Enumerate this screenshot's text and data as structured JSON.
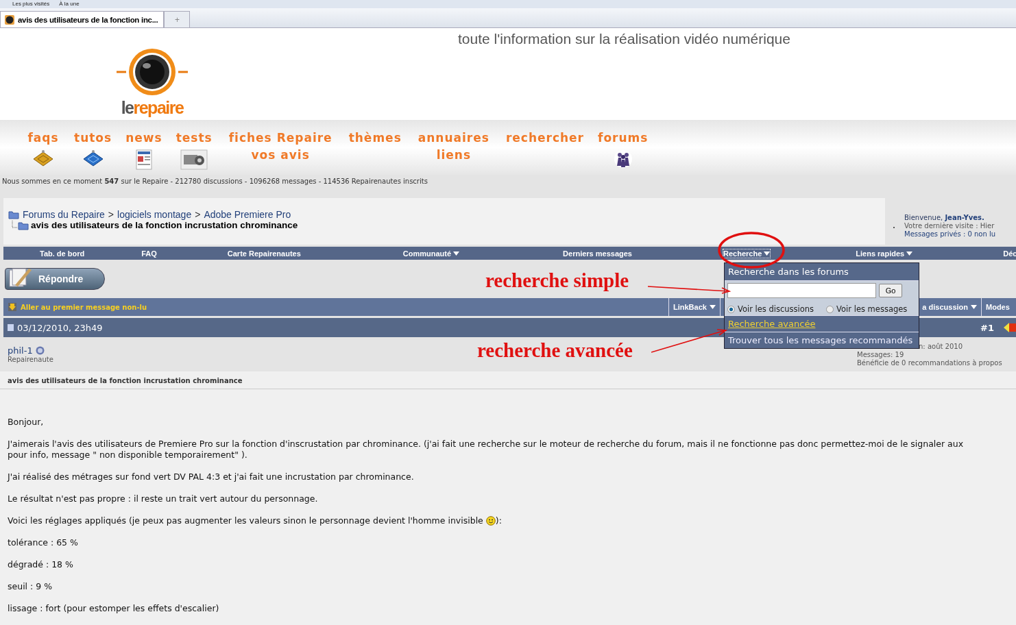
{
  "bookmarks": [
    "Les plus visités",
    "À la une"
  ],
  "browser_tabs": [
    {
      "label": "avis des utilisateurs de la fonction inc...",
      "selected": true,
      "kind": "page"
    },
    {
      "label": "+",
      "selected": false,
      "kind": "new"
    }
  ],
  "site": {
    "tagline": "toute l'information sur la réalisation vidéo numérique",
    "logo": {
      "first": "le",
      "second": "repaire"
    }
  },
  "site_menu": [
    {
      "lines": [
        "faqs"
      ]
    },
    {
      "lines": [
        "tutos"
      ]
    },
    {
      "lines": [
        "news"
      ]
    },
    {
      "lines": [
        "tests"
      ]
    },
    {
      "lines": [
        "fiches Repaire",
        "vos avis"
      ]
    },
    {
      "lines": [
        "thèmes"
      ]
    },
    {
      "lines": [
        "annuaires",
        "liens"
      ]
    },
    {
      "lines": [
        "rechercher"
      ]
    },
    {
      "lines": [
        "forums"
      ]
    }
  ],
  "stats": "Nous sommes en ce moment **547** sur le Repaire - 212780 discussions - 1096268 messages - 114536 Repairenautes inscrits",
  "breadcrumb": {
    "path": [
      "Forums du Repaire",
      "logiciels montage",
      "Adobe Premiere Pro"
    ],
    "separator": ">",
    "current": "avis des utilisateurs de la fonction incrustation chrominance"
  },
  "welcome": {
    "greeting": "Bienvenue, ",
    "user": "Jean-Yves.",
    "last_visit": "Votre dernière visite : Hier",
    "private": "Messages privés : 0 non lu"
  },
  "navbar": [
    {
      "label": "Tab. de bord",
      "dropdown": false,
      "selected": false
    },
    {
      "label": "FAQ",
      "dropdown": false,
      "selected": false
    },
    {
      "label": "Carte Repairenautes",
      "dropdown": false,
      "selected": false
    },
    {
      "label": "Communauté",
      "dropdown": true,
      "selected": false
    },
    {
      "label": "Derniers messages",
      "dropdown": false,
      "selected": false
    },
    {
      "label": "Recherche",
      "dropdown": true,
      "selected": true
    },
    {
      "label": "Liens rapides",
      "dropdown": true,
      "selected": false
    },
    {
      "label": "Déc",
      "dropdown": false,
      "selected": false
    }
  ],
  "reply_button": "Répondre",
  "thread_bar": {
    "first_unread": "Aller au premier message non-lu",
    "tools": [
      {
        "label": "LinkBack",
        "dropdown": true
      },
      {
        "label": "a discussion",
        "dropdown": true
      },
      {
        "label": "Modes"
      }
    ]
  },
  "post": {
    "date": "03/12/2010, 23h49",
    "number": "#1",
    "author": "phil-1",
    "rank": "Repairenaute",
    "info": [
      "n: août 2010",
      "Messages: 19",
      "Bénéficie de 0 recommandations à propos"
    ],
    "title": "avis des utilisateurs de la fonction incrustation chrominance",
    "paragraphs": [
      [
        "Bonjour,"
      ],
      [
        "J'aimerais l'avis des utilisateurs de Premiere Pro sur la fonction d'inscrustation par chrominance. (j'ai fait une recherche sur le moteur de recherche du forum, mais il ne fonctionne pas donc permettez-moi de le signaler aux",
        "pour info, message \" non disponible temporairement\" )."
      ],
      [
        "J'ai réalisé des métrages sur fond vert DV PAL 4:3 et j'ai fait une incrustation par chrominance."
      ],
      [
        "Le résultat n'est pas propre : il reste un trait vert autour du personnage."
      ],
      [
        "Voici les réglages appliqués (je peux pas augmenter les valeurs sinon le personnage devient l'homme invisible",
        "):"
      ],
      [
        "tolérance : 65 %"
      ],
      [
        "dégradé : 18 %"
      ],
      [
        "seuil : 9 %"
      ],
      [
        "lissage : fort (pour estomper les effets d'escalier)"
      ]
    ]
  },
  "search_menu": {
    "title": "Recherche dans les forums",
    "go": "Go",
    "options": [
      {
        "label": "Voir les discussions",
        "selected": true
      },
      {
        "label": "Voir les messages",
        "selected": false
      }
    ],
    "advanced": "Recherche avancée",
    "recommended": "Trouver tous les messages recommandés"
  },
  "annotations": [
    "recherche simple",
    "recherche avancée"
  ]
}
